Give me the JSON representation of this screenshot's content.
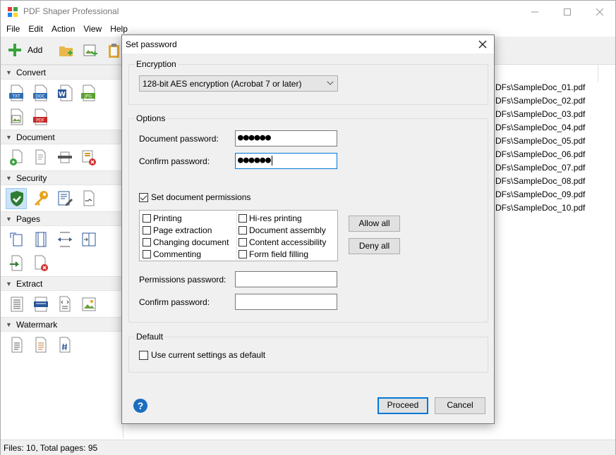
{
  "app": {
    "title": "PDF Shaper Professional"
  },
  "menu": [
    "File",
    "Edit",
    "Action",
    "View",
    "Help"
  ],
  "toolbar": {
    "add_label": "Add"
  },
  "sidebar": {
    "sections": [
      {
        "label": "Convert"
      },
      {
        "label": "Document"
      },
      {
        "label": "Security"
      },
      {
        "label": "Pages"
      },
      {
        "label": "Extract"
      },
      {
        "label": "Watermark"
      }
    ],
    "convert_icons": [
      "TXT",
      "DOC",
      "W",
      "JPG",
      "PDF"
    ]
  },
  "files": [
    "DFs\\SampleDoc_01.pdf",
    "DFs\\SampleDoc_02.pdf",
    "DFs\\SampleDoc_03.pdf",
    "DFs\\SampleDoc_04.pdf",
    "DFs\\SampleDoc_05.pdf",
    "DFs\\SampleDoc_06.pdf",
    "DFs\\SampleDoc_07.pdf",
    "DFs\\SampleDoc_08.pdf",
    "DFs\\SampleDoc_09.pdf",
    "DFs\\SampleDoc_10.pdf"
  ],
  "status": {
    "text": "Files: 10, Total pages: 95"
  },
  "dialog": {
    "title": "Set password",
    "encryption": {
      "group_label": "Encryption",
      "selected": "128-bit AES encryption (Acrobat 7 or later)"
    },
    "options": {
      "group_label": "Options",
      "doc_password_label": "Document password:",
      "doc_password_value": "●●●●●●",
      "confirm_password_label": "Confirm password:",
      "confirm_password_value": "●●●●●●",
      "set_permissions_label": "Set document permissions",
      "set_permissions_checked": true,
      "permissions": [
        {
          "label": "Printing",
          "checked": false
        },
        {
          "label": "Page extraction",
          "checked": false
        },
        {
          "label": "Changing document",
          "checked": false
        },
        {
          "label": "Commenting",
          "checked": false
        },
        {
          "label": "Hi-res printing",
          "checked": false
        },
        {
          "label": "Document assembly",
          "checked": false
        },
        {
          "label": "Content accessibility",
          "checked": false
        },
        {
          "label": "Form field filling",
          "checked": false
        }
      ],
      "allow_all_label": "Allow all",
      "deny_all_label": "Deny all",
      "perm_password_label": "Permissions password:",
      "perm_confirm_label": "Confirm password:"
    },
    "default": {
      "group_label": "Default",
      "use_current_label": "Use current settings as default",
      "use_current_checked": false
    },
    "help_glyph": "?",
    "proceed_label": "Proceed",
    "cancel_label": "Cancel"
  },
  "colors": {
    "accent": "#0078d7",
    "add_green": "#3aa33a",
    "help_blue": "#1b6dc1"
  }
}
